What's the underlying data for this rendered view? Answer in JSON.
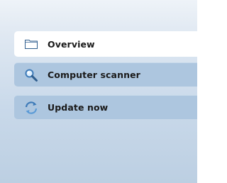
{
  "nav": {
    "items": [
      {
        "label": "Overview",
        "icon": "folder-icon",
        "active": true
      },
      {
        "label": "Computer scanner",
        "icon": "search-icon",
        "active": false
      },
      {
        "label": "Update now",
        "icon": "update-icon",
        "active": false
      }
    ]
  },
  "colors": {
    "panel_background": "#c9d9ea",
    "active_item_background": "#ffffff",
    "inactive_item_background": "#adc6df",
    "text": "#1a1a1a",
    "icon_accent": "#4a86c5"
  }
}
